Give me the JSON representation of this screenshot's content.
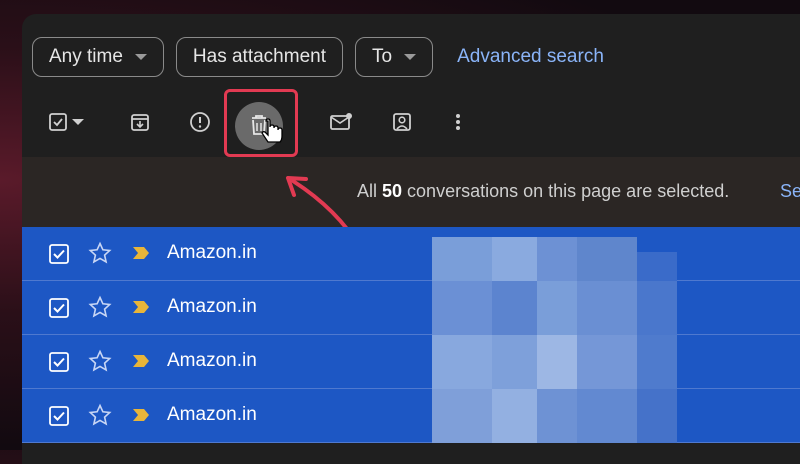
{
  "filters": {
    "chips": [
      {
        "label": "Any time",
        "has_dropdown": true
      },
      {
        "label": "Has attachment",
        "has_dropdown": false
      },
      {
        "label": "To",
        "has_dropdown": true
      }
    ],
    "advanced_search_label": "Advanced search"
  },
  "toolbar": {
    "icons": [
      "select-all-checkbox-icon",
      "archive-icon",
      "report-spam-icon",
      "delete-icon",
      "mark-unread-icon",
      "move-to-icon",
      "more-options-icon"
    ],
    "highlighted": "delete-icon"
  },
  "selection_banner": {
    "prefix": "All ",
    "count": "50",
    "suffix": " conversations on this page are selected.",
    "link_text": "Se"
  },
  "email_rows": [
    {
      "sender": "Amazon.in",
      "checked": true
    },
    {
      "sender": "Amazon.in",
      "checked": true
    },
    {
      "sender": "Amazon.in",
      "checked": true
    },
    {
      "sender": "Amazon.in",
      "checked": true
    }
  ],
  "colors": {
    "window_bg": "#1f1f1f",
    "selected_row": "#1d57c4",
    "link": "#8ab4f8",
    "highlight": "#e23a52",
    "important_marker": "#e8b53a"
  }
}
